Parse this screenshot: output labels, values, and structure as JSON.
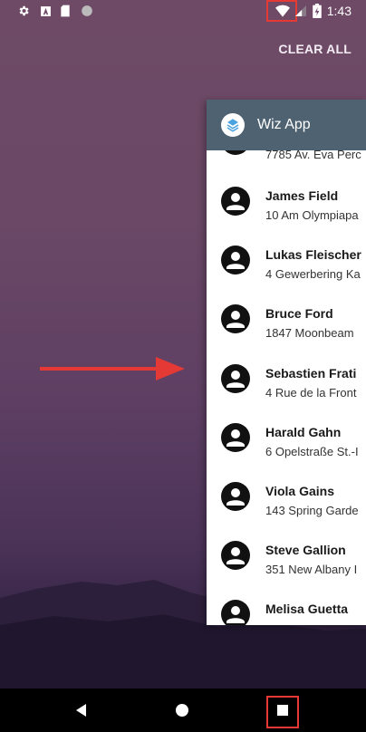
{
  "status_bar": {
    "time": "1:43",
    "left_icons": [
      "gear-icon",
      "a-icon",
      "sd-card-icon",
      "circle-icon"
    ],
    "right_icons": [
      "wifi-icon",
      "signal-icon",
      "battery-icon"
    ]
  },
  "recents": {
    "clear_all_label": "CLEAR ALL"
  },
  "app_card": {
    "title": "Wiz App",
    "contacts": [
      {
        "name": "",
        "address": "7785 Av. Eva Perc"
      },
      {
        "name": "James Field",
        "address": "10 Am Olympiapa"
      },
      {
        "name": "Lukas Fleischer",
        "address": "4 Gewerbering Ka"
      },
      {
        "name": "Bruce Ford",
        "address": "1847 Moonbeam"
      },
      {
        "name": "Sebastien Frati",
        "address": "4 Rue de la Front"
      },
      {
        "name": "Harald Gahn",
        "address": "6 Opelstraße St.-I"
      },
      {
        "name": "Viola Gains",
        "address": "143 Spring Garde"
      },
      {
        "name": "Steve Gallion",
        "address": "351 New Albany I"
      },
      {
        "name": "Melisa Guetta",
        "address": ""
      }
    ]
  },
  "nav_bar": {
    "buttons": [
      "back-icon",
      "home-icon",
      "recents-icon"
    ]
  },
  "colors": {
    "annotation": "#e53935",
    "header": "#4f6272"
  }
}
